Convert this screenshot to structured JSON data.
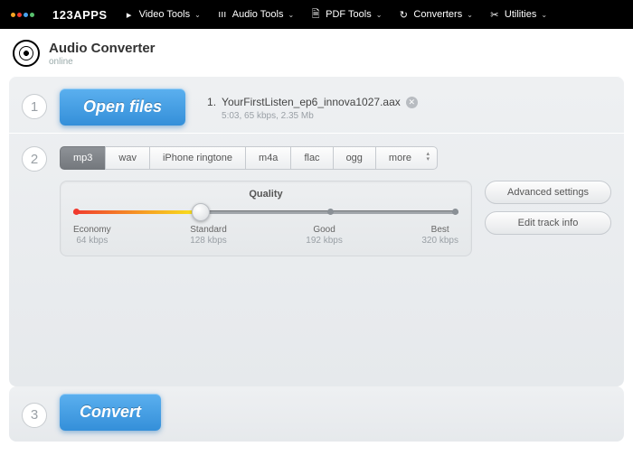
{
  "brand": "123APPS",
  "brand_dots": [
    "#f6a623",
    "#f03a2e",
    "#4aa3f0",
    "#59c16e"
  ],
  "nav": [
    {
      "icon": "video",
      "label": "Video Tools"
    },
    {
      "icon": "audio",
      "label": "Audio Tools"
    },
    {
      "icon": "pdf",
      "label": "PDF Tools"
    },
    {
      "icon": "convert",
      "label": "Converters"
    },
    {
      "icon": "util",
      "label": "Utilities"
    }
  ],
  "app": {
    "title": "Audio Converter",
    "sub": "online"
  },
  "step1": {
    "open_label": "Open files",
    "file": {
      "index": "1.",
      "name": "YourFirstListen_ep6_innova1027.aax",
      "meta": "5:03, 65 kbps, 2.35 Mb"
    }
  },
  "step2": {
    "formats": [
      "mp3",
      "wav",
      "iPhone ringtone",
      "m4a",
      "flac",
      "ogg",
      "more"
    ],
    "active": 0,
    "quality_title": "Quality",
    "labels": [
      {
        "name": "Economy",
        "br": "64 kbps"
      },
      {
        "name": "Standard",
        "br": "128 kbps"
      },
      {
        "name": "Good",
        "br": "192 kbps"
      },
      {
        "name": "Best",
        "br": "320 kbps"
      }
    ],
    "advanced": "Advanced settings",
    "trackinfo": "Edit track info"
  },
  "step3": {
    "convert": "Convert"
  }
}
